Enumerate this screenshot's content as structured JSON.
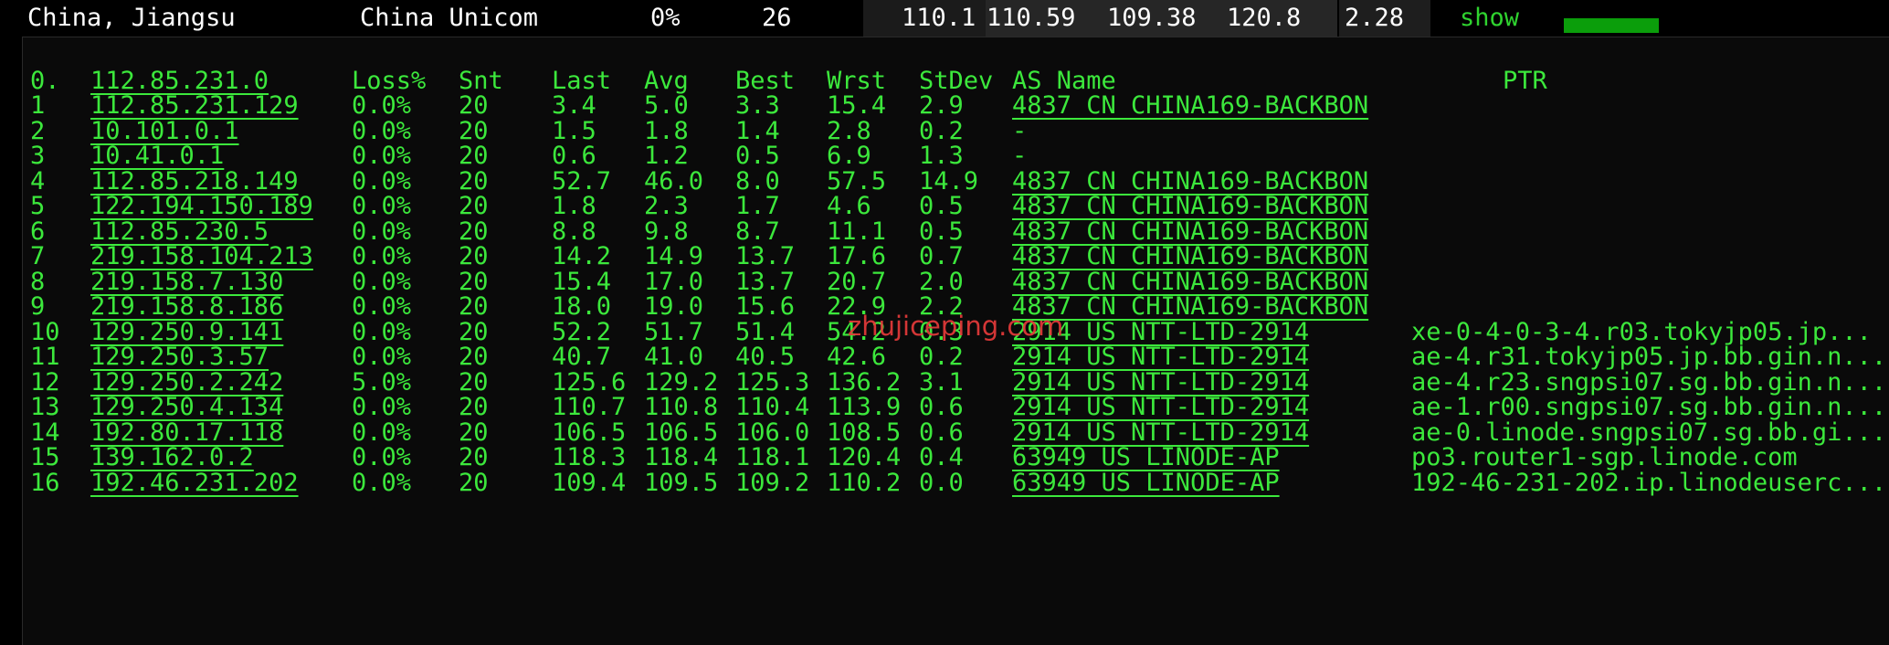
{
  "summary": {
    "location": "China, Jiangsu",
    "isp": "China Unicom",
    "loss": "0%",
    "sent": "26",
    "last": "110.1",
    "avg": "110.59",
    "best": "109.38",
    "worst": "120.8",
    "stdev": "2.28",
    "show_label": "show",
    "bar_fill_fraction": 1.0,
    "bar_color": "#0b9e0b"
  },
  "colors": {
    "background": "#000000",
    "panel": "#0a0a0a",
    "text": "#3ce83c",
    "watermark": "#e63a3a"
  },
  "header": {
    "hop": "0.",
    "host": "112.85.231.0",
    "loss": "Loss%",
    "snt": "Snt",
    "last": "Last",
    "avg": "Avg",
    "best": "Best",
    "wrst": "Wrst",
    "stdev": "StDev",
    "as": "AS Name",
    "ptr": "PTR"
  },
  "hops": [
    {
      "hop": "1",
      "host": "112.85.231.129",
      "loss": "0.0%",
      "snt": "20",
      "last": "3.4",
      "avg": "5.0",
      "best": "3.3",
      "wrst": "15.4",
      "stdev": "2.9",
      "as": "4837  CN CHINA169-BACKBON",
      "ptr": ""
    },
    {
      "hop": "2",
      "host": "10.101.0.1",
      "loss": "0.0%",
      "snt": "20",
      "last": "1.5",
      "avg": "1.8",
      "best": "1.4",
      "wrst": "2.8",
      "stdev": "0.2",
      "as": "-",
      "ptr": ""
    },
    {
      "hop": "3",
      "host": "10.41.0.1",
      "loss": "0.0%",
      "snt": "20",
      "last": "0.6",
      "avg": "1.2",
      "best": "0.5",
      "wrst": "6.9",
      "stdev": "1.3",
      "as": "-",
      "ptr": ""
    },
    {
      "hop": "4",
      "host": "112.85.218.149",
      "loss": "0.0%",
      "snt": "20",
      "last": "52.7",
      "avg": "46.0",
      "best": "8.0",
      "wrst": "57.5",
      "stdev": "14.9",
      "as": "4837  CN CHINA169-BACKBON",
      "ptr": ""
    },
    {
      "hop": "5",
      "host": "122.194.150.189",
      "loss": "0.0%",
      "snt": "20",
      "last": "1.8",
      "avg": "2.3",
      "best": "1.7",
      "wrst": "4.6",
      "stdev": "0.5",
      "as": "4837  CN CHINA169-BACKBON",
      "ptr": ""
    },
    {
      "hop": "6",
      "host": "112.85.230.5",
      "loss": "0.0%",
      "snt": "20",
      "last": "8.8",
      "avg": "9.8",
      "best": "8.7",
      "wrst": "11.1",
      "stdev": "0.5",
      "as": "4837  CN CHINA169-BACKBON",
      "ptr": ""
    },
    {
      "hop": "7",
      "host": "219.158.104.213",
      "loss": "0.0%",
      "snt": "20",
      "last": "14.2",
      "avg": "14.9",
      "best": "13.7",
      "wrst": "17.6",
      "stdev": "0.7",
      "as": "4837  CN CHINA169-BACKBON",
      "ptr": ""
    },
    {
      "hop": "8",
      "host": "219.158.7.130",
      "loss": "0.0%",
      "snt": "20",
      "last": "15.4",
      "avg": "17.0",
      "best": "13.7",
      "wrst": "20.7",
      "stdev": "2.0",
      "as": "4837  CN CHINA169-BACKBON",
      "ptr": ""
    },
    {
      "hop": "9",
      "host": "219.158.8.186",
      "loss": "0.0%",
      "snt": "20",
      "last": "18.0",
      "avg": "19.0",
      "best": "15.6",
      "wrst": "22.9",
      "stdev": "2.2",
      "as": "4837  CN CHINA169-BACKBON",
      "ptr": ""
    },
    {
      "hop": "10",
      "host": "129.250.9.141",
      "loss": "0.0%",
      "snt": "20",
      "last": "52.2",
      "avg": "51.7",
      "best": "51.4",
      "wrst": "54.2",
      "stdev": "0.3",
      "as": "2914  US NTT-LTD-2914",
      "ptr": "xe-0-4-0-3-4.r03.tokyjp05.jp..."
    },
    {
      "hop": "11",
      "host": "129.250.3.57",
      "loss": "0.0%",
      "snt": "20",
      "last": "40.7",
      "avg": "41.0",
      "best": "40.5",
      "wrst": "42.6",
      "stdev": "0.2",
      "as": "2914  US NTT-LTD-2914",
      "ptr": "ae-4.r31.tokyjp05.jp.bb.gin.n..."
    },
    {
      "hop": "12",
      "host": "129.250.2.242",
      "loss": "5.0%",
      "snt": "20",
      "last": "125.6",
      "avg": "129.2",
      "best": "125.3",
      "wrst": "136.2",
      "stdev": "3.1",
      "as": "2914  US NTT-LTD-2914",
      "ptr": "ae-4.r23.sngpsi07.sg.bb.gin.n..."
    },
    {
      "hop": "13",
      "host": "129.250.4.134",
      "loss": "0.0%",
      "snt": "20",
      "last": "110.7",
      "avg": "110.8",
      "best": "110.4",
      "wrst": "113.9",
      "stdev": "0.6",
      "as": "2914  US NTT-LTD-2914",
      "ptr": "ae-1.r00.sngpsi07.sg.bb.gin.n..."
    },
    {
      "hop": "14",
      "host": "192.80.17.118",
      "loss": "0.0%",
      "snt": "20",
      "last": "106.5",
      "avg": "106.5",
      "best": "106.0",
      "wrst": "108.5",
      "stdev": "0.6",
      "as": "2914  US NTT-LTD-2914",
      "ptr": "ae-0.linode.sngpsi07.sg.bb.gi..."
    },
    {
      "hop": "15",
      "host": "139.162.0.2",
      "loss": "0.0%",
      "snt": "20",
      "last": "118.3",
      "avg": "118.4",
      "best": "118.1",
      "wrst": "120.4",
      "stdev": "0.4",
      "as": "63949 US LINODE-AP",
      "ptr": "po3.router1-sgp.linode.com"
    },
    {
      "hop": "16",
      "host": "192.46.231.202",
      "loss": "0.0%",
      "snt": "20",
      "last": "109.4",
      "avg": "109.5",
      "best": "109.2",
      "wrst": "110.2",
      "stdev": "0.0",
      "as": "63949 US LINODE-AP",
      "ptr": "192-46-231-202.ip.linodeuserc..."
    }
  ],
  "watermark": "zhujiceping.com"
}
